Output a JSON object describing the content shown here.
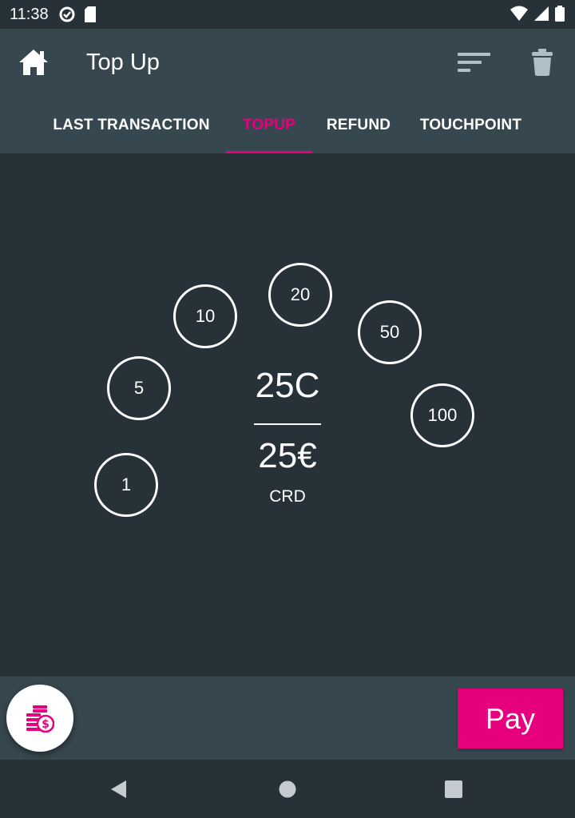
{
  "status_bar": {
    "time": "11:38",
    "icons": [
      "data-saver-icon",
      "sd-card-icon",
      "wifi-icon",
      "signal-icon",
      "battery-icon"
    ]
  },
  "app_bar": {
    "title": "Top Up",
    "icons": [
      "home-icon",
      "sort-icon",
      "trash-icon"
    ]
  },
  "tabs": [
    {
      "label": "LAST TRANSACTION",
      "active": false
    },
    {
      "label": "TOPUP",
      "active": true
    },
    {
      "label": "REFUND",
      "active": false
    },
    {
      "label": "TOUCHPOINT",
      "active": false
    }
  ],
  "amount_options": [
    "1",
    "5",
    "10",
    "20",
    "50",
    "100"
  ],
  "summary": {
    "credits": "25C",
    "euros": "25€",
    "unit": "CRD"
  },
  "bottom_bar": {
    "fab_icon": "coins-icon",
    "pay_label": "Pay"
  },
  "nav_bar": {
    "icons": [
      "back-icon",
      "home-circle-icon",
      "recents-icon"
    ]
  },
  "colors": {
    "accent": "#e6007e",
    "background": "#263238",
    "app_bar": "#37474f"
  }
}
